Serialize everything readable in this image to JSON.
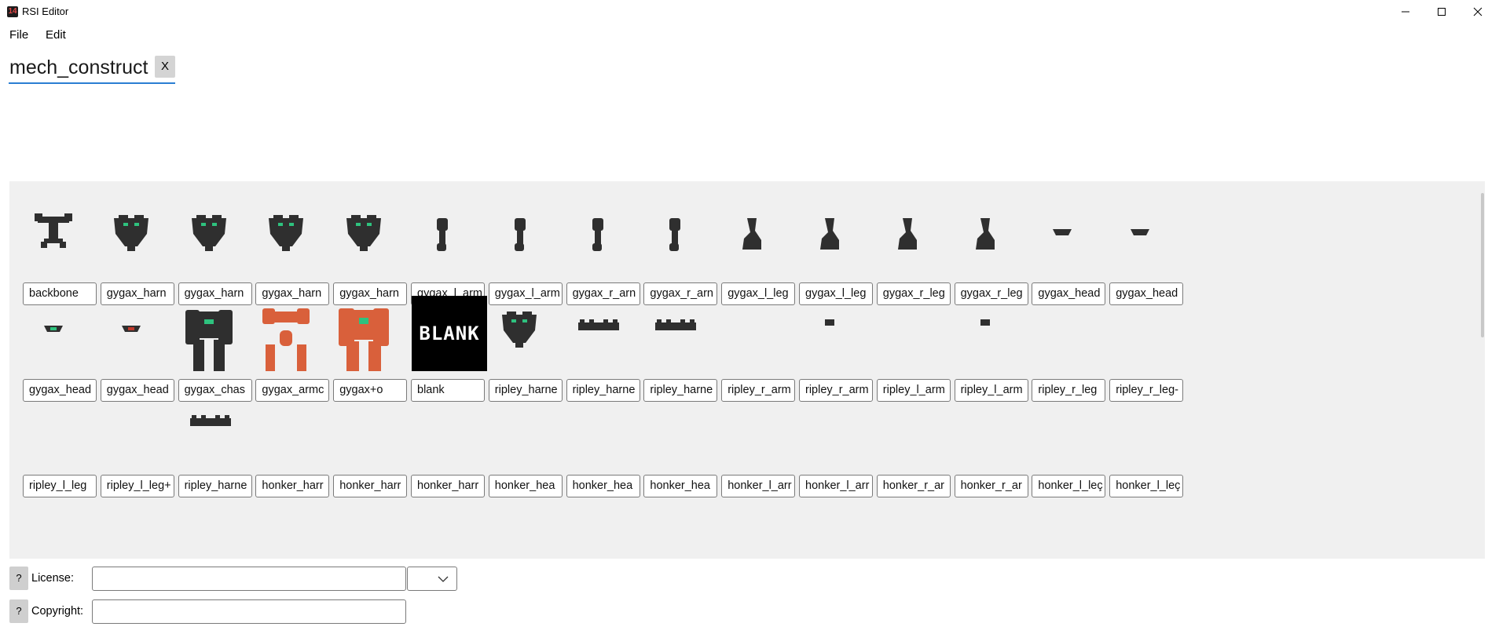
{
  "window": {
    "title": "RSI Editor",
    "app_icon_glyph": "14",
    "controls": [
      "minimize-icon",
      "maximize-icon",
      "close-icon"
    ]
  },
  "menu": {
    "items": [
      "File",
      "Edit"
    ]
  },
  "tab": {
    "label": "mech_construct",
    "close_label": "X"
  },
  "states": [
    {
      "label": "backbone",
      "icon": "backbone-sprite"
    },
    {
      "label": "gygax_harn",
      "icon": "harness-sprite"
    },
    {
      "label": "gygax_harn",
      "icon": "harness-sprite"
    },
    {
      "label": "gygax_harn",
      "icon": "harness-sprite"
    },
    {
      "label": "gygax_harn",
      "icon": "harness-sprite"
    },
    {
      "label": "gygax_l_arm",
      "icon": "arm-sprite"
    },
    {
      "label": "gygax_l_arm",
      "icon": "arm-sprite"
    },
    {
      "label": "gygax_r_arn",
      "icon": "arm-sprite"
    },
    {
      "label": "gygax_r_arn",
      "icon": "arm-sprite"
    },
    {
      "label": "gygax_l_leg",
      "icon": "leg-sprite"
    },
    {
      "label": "gygax_l_leg",
      "icon": "leg-sprite"
    },
    {
      "label": "gygax_r_leg",
      "icon": "leg-sprite"
    },
    {
      "label": "gygax_r_leg",
      "icon": "leg-sprite"
    },
    {
      "label": "gygax_head",
      "icon": "head-sprite"
    },
    {
      "label": "gygax_head",
      "icon": "head-sprite"
    },
    {
      "label": "gygax_head",
      "icon": "head-sprite"
    },
    {
      "label": "gygax_head",
      "icon": "head-sprite"
    },
    {
      "label": "gygax_chas",
      "icon": "chassis-sprite"
    },
    {
      "label": "gygax_armc",
      "icon": "armor-sprite"
    },
    {
      "label": "gygax+o",
      "icon": "full-mech-sprite"
    },
    {
      "label": "blank",
      "icon": "blank-tile",
      "tile_text": "BLANK"
    },
    {
      "label": "ripley_harne",
      "icon": "harness-sprite"
    },
    {
      "label": "ripley_harne",
      "icon": "harness-flat-sprite"
    },
    {
      "label": "ripley_harne",
      "icon": "harness-flat-sprite"
    },
    {
      "label": "ripley_r_arm",
      "icon": "empty"
    },
    {
      "label": "ripley_r_arm",
      "icon": "small-part-sprite"
    },
    {
      "label": "ripley_l_arm",
      "icon": "empty"
    },
    {
      "label": "ripley_l_arm",
      "icon": "small-part-sprite"
    },
    {
      "label": "ripley_r_leg",
      "icon": "empty"
    },
    {
      "label": "ripley_r_leg-",
      "icon": "empty"
    },
    {
      "label": "ripley_l_leg",
      "icon": "empty"
    },
    {
      "label": "ripley_l_leg+",
      "icon": "empty"
    },
    {
      "label": "ripley_harne",
      "icon": "harness-flat-sprite"
    },
    {
      "label": "honker_harr",
      "icon": "empty"
    },
    {
      "label": "honker_harr",
      "icon": "empty"
    },
    {
      "label": "honker_harr",
      "icon": "empty"
    },
    {
      "label": "honker_hea",
      "icon": "empty"
    },
    {
      "label": "honker_hea",
      "icon": "empty"
    },
    {
      "label": "honker_hea",
      "icon": "empty"
    },
    {
      "label": "honker_l_arr",
      "icon": "empty"
    },
    {
      "label": "honker_l_arr",
      "icon": "empty"
    },
    {
      "label": "honker_r_ar",
      "icon": "empty"
    },
    {
      "label": "honker_r_ar",
      "icon": "empty"
    },
    {
      "label": "honker_l_leç",
      "icon": "empty"
    },
    {
      "label": "honker_l_leç",
      "icon": "empty"
    }
  ],
  "license": {
    "help": "?",
    "label": "License:",
    "value": "",
    "select_value": ""
  },
  "copyright": {
    "help": "?",
    "label": "Copyright:",
    "value": ""
  },
  "colors": {
    "accent": "#2a7ed3",
    "panel": "#f0f0f0",
    "sprite_dark": "#2f2f2f",
    "sprite_green": "#2ec27e",
    "sprite_red": "#c0392b",
    "sprite_orange": "#d9603b"
  }
}
